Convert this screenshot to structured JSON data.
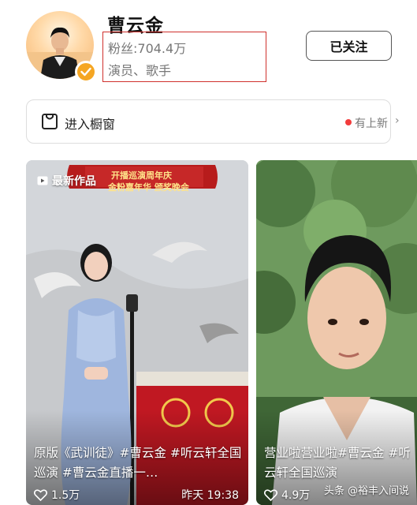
{
  "profile": {
    "name": "曹云金",
    "fans": "粉丝:704.4万",
    "job": "演员、歌手",
    "follow_label": "已关注"
  },
  "showcase": {
    "label": "进入橱窗",
    "new_label": "有上新",
    "chevron": "›"
  },
  "videos": [
    {
      "badge": "最新作品",
      "banner_line1": "开播巡演周年庆",
      "banner_line2": "金粉嘉年华 颁奖晚会",
      "caption": "原版《武训徒》#曹云金 #听云轩全国巡演 #曹云金直播一…",
      "likes": "1.5万",
      "time": "昨天 19:38"
    },
    {
      "caption": "营业啦营业啦#曹云金 #听云轩全国巡演",
      "likes": "4.9万",
      "time": ""
    }
  ],
  "watermark": "头条 @裕丰入间说",
  "colors": {
    "highlight_box": "#d0312d",
    "verified": "#f5a623",
    "new_dot": "#f23c3c"
  }
}
